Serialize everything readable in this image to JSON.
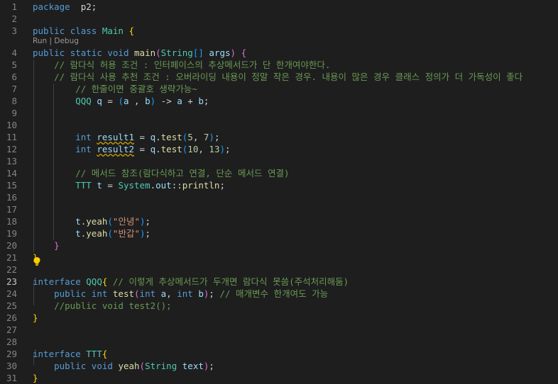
{
  "editor": {
    "codelens": {
      "run": "Run",
      "separator": " | ",
      "debug": "Debug"
    },
    "active_line": "23",
    "lines": [
      {
        "n": "1",
        "tokens": [
          [
            "kw",
            "package"
          ],
          [
            "",
            "  "
          ],
          [
            "",
            "p2;"
          ]
        ]
      },
      {
        "n": "2",
        "tokens": []
      },
      {
        "n": "3",
        "tokens": [
          [
            "kw",
            "public"
          ],
          [
            "",
            " "
          ],
          [
            "kw",
            "class"
          ],
          [
            "",
            " "
          ],
          [
            "cls",
            "Main"
          ],
          [
            "",
            " "
          ],
          [
            "p1",
            "{"
          ]
        ]
      },
      {
        "n": "4",
        "tokens": [
          [
            "kw",
            "public"
          ],
          [
            "",
            " "
          ],
          [
            "kw",
            "static"
          ],
          [
            "",
            " "
          ],
          [
            "kw",
            "void"
          ],
          [
            "",
            " "
          ],
          [
            "fn",
            "main"
          ],
          [
            "p2",
            "("
          ],
          [
            "cls",
            "String"
          ],
          [
            "p3",
            "[]"
          ],
          [
            "",
            " "
          ],
          [
            "var",
            "args"
          ],
          [
            "p2",
            ")"
          ],
          [
            "",
            " "
          ],
          [
            "p2",
            "{"
          ]
        ]
      },
      {
        "n": "5",
        "tokens": [
          [
            "",
            "    "
          ],
          [
            "cm",
            "// 람다식 허용 조건 : 인터페이스의 추상메서드가 단 한개여야한다."
          ]
        ]
      },
      {
        "n": "6",
        "tokens": [
          [
            "",
            "    "
          ],
          [
            "cm",
            "// 람다식 사용 추천 조건 : 오버라이딩 내용이 정말 작은 경우. 내용이 많은 경우 클래스 정의가 더 가독성이 좋다"
          ]
        ]
      },
      {
        "n": "7",
        "tokens": [
          [
            "",
            "        "
          ],
          [
            "cm",
            "// 한줄이면 중괄호 생략가능~"
          ]
        ]
      },
      {
        "n": "8",
        "tokens": [
          [
            "",
            "        "
          ],
          [
            "cls",
            "QQQ"
          ],
          [
            "",
            " "
          ],
          [
            "var",
            "q"
          ],
          [
            "",
            " = "
          ],
          [
            "p3",
            "("
          ],
          [
            "var",
            "a"
          ],
          [
            "",
            " , "
          ],
          [
            "var",
            "b"
          ],
          [
            "p3",
            ")"
          ],
          [
            "",
            " -> "
          ],
          [
            "var",
            "a"
          ],
          [
            "",
            " + "
          ],
          [
            "var",
            "b"
          ],
          [
            "",
            ";"
          ]
        ]
      },
      {
        "n": "9",
        "tokens": []
      },
      {
        "n": "10",
        "tokens": []
      },
      {
        "n": "11",
        "tokens": [
          [
            "",
            "        "
          ],
          [
            "kw",
            "int"
          ],
          [
            "",
            " "
          ],
          [
            "var squig",
            "result1"
          ],
          [
            "",
            " = "
          ],
          [
            "var",
            "q"
          ],
          [
            "",
            "."
          ],
          [
            "fn",
            "test"
          ],
          [
            "p3",
            "("
          ],
          [
            "num",
            "5"
          ],
          [
            "",
            ", "
          ],
          [
            "num",
            "7"
          ],
          [
            "p3",
            ")"
          ],
          [
            "",
            ";"
          ]
        ]
      },
      {
        "n": "12",
        "tokens": [
          [
            "",
            "        "
          ],
          [
            "kw",
            "int"
          ],
          [
            "",
            " "
          ],
          [
            "var squig",
            "result2"
          ],
          [
            "",
            " = "
          ],
          [
            "var",
            "q"
          ],
          [
            "",
            "."
          ],
          [
            "fn",
            "test"
          ],
          [
            "p3",
            "("
          ],
          [
            "num",
            "10"
          ],
          [
            "",
            ", "
          ],
          [
            "num",
            "13"
          ],
          [
            "p3",
            ")"
          ],
          [
            "",
            ";"
          ]
        ]
      },
      {
        "n": "13",
        "tokens": []
      },
      {
        "n": "14",
        "tokens": [
          [
            "",
            "        "
          ],
          [
            "cm",
            "// 메서드 참조(람다식하고 연결, 단순 메서드 연결)"
          ]
        ]
      },
      {
        "n": "15",
        "tokens": [
          [
            "",
            "        "
          ],
          [
            "cls",
            "TTT"
          ],
          [
            "",
            " "
          ],
          [
            "var",
            "t"
          ],
          [
            "",
            " = "
          ],
          [
            "cls",
            "System"
          ],
          [
            "",
            "."
          ],
          [
            "var",
            "out"
          ],
          [
            "",
            "::"
          ],
          [
            "fn",
            "println"
          ],
          [
            "",
            ";"
          ]
        ]
      },
      {
        "n": "16",
        "tokens": []
      },
      {
        "n": "17",
        "tokens": []
      },
      {
        "n": "18",
        "tokens": [
          [
            "",
            "        "
          ],
          [
            "var",
            "t"
          ],
          [
            "",
            "."
          ],
          [
            "fn",
            "yeah"
          ],
          [
            "p3",
            "("
          ],
          [
            "str",
            "\"안녕\""
          ],
          [
            "p3",
            ")"
          ],
          [
            "",
            ";"
          ]
        ]
      },
      {
        "n": "19",
        "tokens": [
          [
            "",
            "        "
          ],
          [
            "var",
            "t"
          ],
          [
            "",
            "."
          ],
          [
            "fn",
            "yeah"
          ],
          [
            "p3",
            "("
          ],
          [
            "str",
            "\"반갑\""
          ],
          [
            "p3",
            ")"
          ],
          [
            "",
            ";"
          ]
        ]
      },
      {
        "n": "20",
        "tokens": [
          [
            "",
            "    "
          ],
          [
            "p2",
            "}"
          ]
        ]
      },
      {
        "n": "21",
        "tokens": [
          [
            "p1",
            "}"
          ]
        ]
      },
      {
        "n": "22",
        "tokens": []
      },
      {
        "n": "23",
        "tokens": [
          [
            "kw",
            "interface"
          ],
          [
            "",
            " "
          ],
          [
            "cls",
            "QQQ"
          ],
          [
            "p1",
            "{"
          ],
          [
            "",
            " "
          ],
          [
            "cm",
            "// 이렇게 추상메서드가 두개면 람다식 못씀(주석처리해둠)"
          ]
        ]
      },
      {
        "n": "24",
        "tokens": [
          [
            "",
            "    "
          ],
          [
            "kw",
            "public"
          ],
          [
            "",
            " "
          ],
          [
            "kw",
            "int"
          ],
          [
            "",
            " "
          ],
          [
            "fn",
            "test"
          ],
          [
            "p2",
            "("
          ],
          [
            "kw",
            "int"
          ],
          [
            "",
            " "
          ],
          [
            "var",
            "a"
          ],
          [
            "",
            ", "
          ],
          [
            "kw",
            "int"
          ],
          [
            "",
            " "
          ],
          [
            "var",
            "b"
          ],
          [
            "p2",
            ")"
          ],
          [
            "",
            "; "
          ],
          [
            "cm",
            "// 매개변수 한개여도 가능"
          ]
        ]
      },
      {
        "n": "25",
        "tokens": [
          [
            "",
            "    "
          ],
          [
            "cm",
            "//public void test2();"
          ]
        ]
      },
      {
        "n": "26",
        "tokens": [
          [
            "p1",
            "}"
          ]
        ]
      },
      {
        "n": "27",
        "tokens": []
      },
      {
        "n": "28",
        "tokens": []
      },
      {
        "n": "29",
        "tokens": [
          [
            "kw",
            "interface"
          ],
          [
            "",
            " "
          ],
          [
            "cls",
            "TTT"
          ],
          [
            "p1",
            "{"
          ]
        ]
      },
      {
        "n": "30",
        "tokens": [
          [
            "",
            "    "
          ],
          [
            "kw",
            "public"
          ],
          [
            "",
            " "
          ],
          [
            "kw",
            "void"
          ],
          [
            "",
            " "
          ],
          [
            "fn",
            "yeah"
          ],
          [
            "p2",
            "("
          ],
          [
            "cls",
            "String"
          ],
          [
            "",
            " "
          ],
          [
            "var",
            "text"
          ],
          [
            "p2",
            ")"
          ],
          [
            "",
            ";"
          ]
        ]
      },
      {
        "n": "31",
        "tokens": [
          [
            "p1",
            "}"
          ]
        ]
      }
    ]
  }
}
